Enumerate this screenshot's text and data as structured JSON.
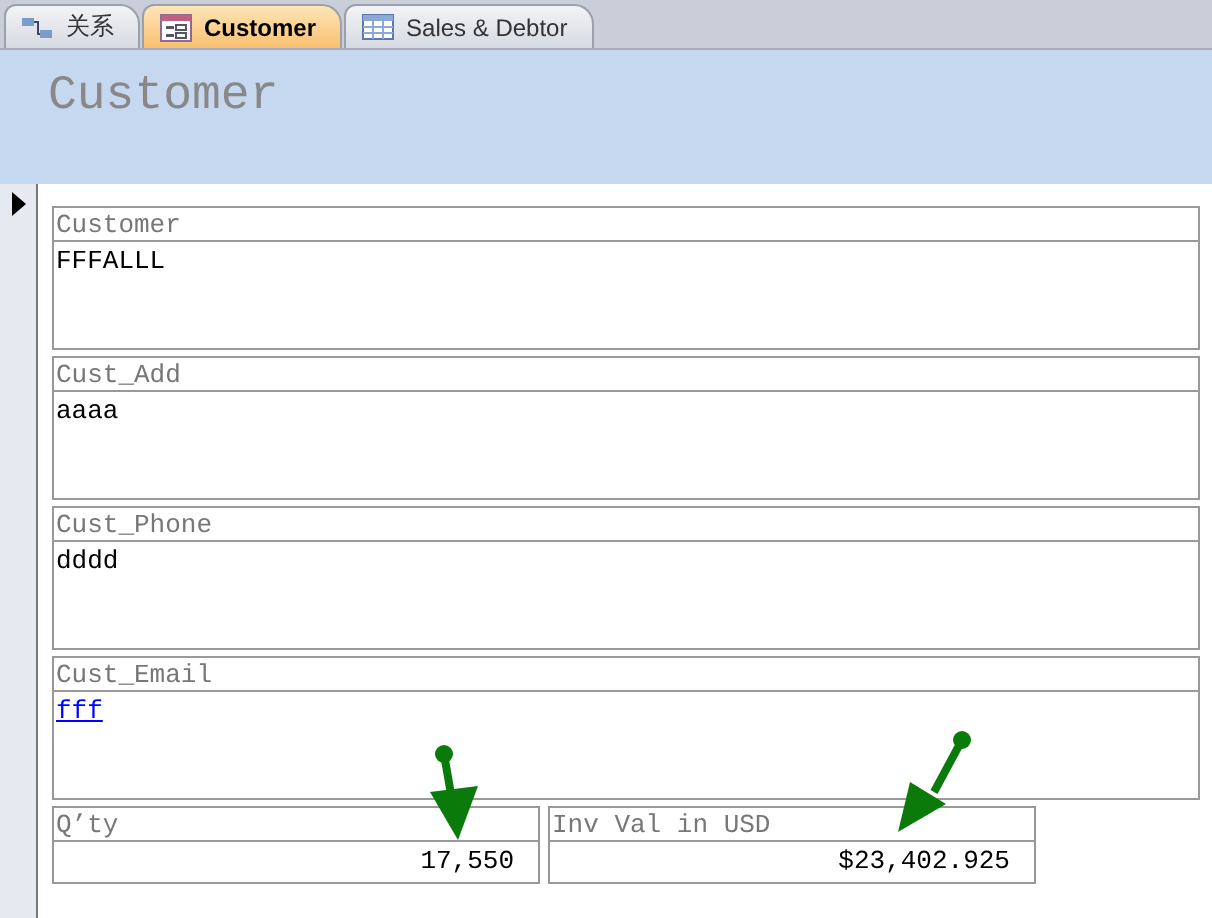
{
  "tabs": [
    {
      "label": "关系",
      "kind": "relationships",
      "selected": false
    },
    {
      "label": "Customer",
      "kind": "form",
      "selected": true
    },
    {
      "label": "Sales & Debtor",
      "kind": "table",
      "selected": false
    }
  ],
  "form_header": {
    "title": "Customer"
  },
  "fields": [
    {
      "label": "Customer",
      "value": "FFFALLL",
      "kind": "text"
    },
    {
      "label": "Cust_Add",
      "value": "aaaa",
      "kind": "text"
    },
    {
      "label": "Cust_Phone",
      "value": "dddd",
      "kind": "text"
    },
    {
      "label": "Cust_Email",
      "value": "fff",
      "kind": "link"
    }
  ],
  "totals": [
    {
      "label": "Q’ty",
      "value": "17,550"
    },
    {
      "label": "Inv Val in USD",
      "value": "$23,402.925"
    }
  ]
}
